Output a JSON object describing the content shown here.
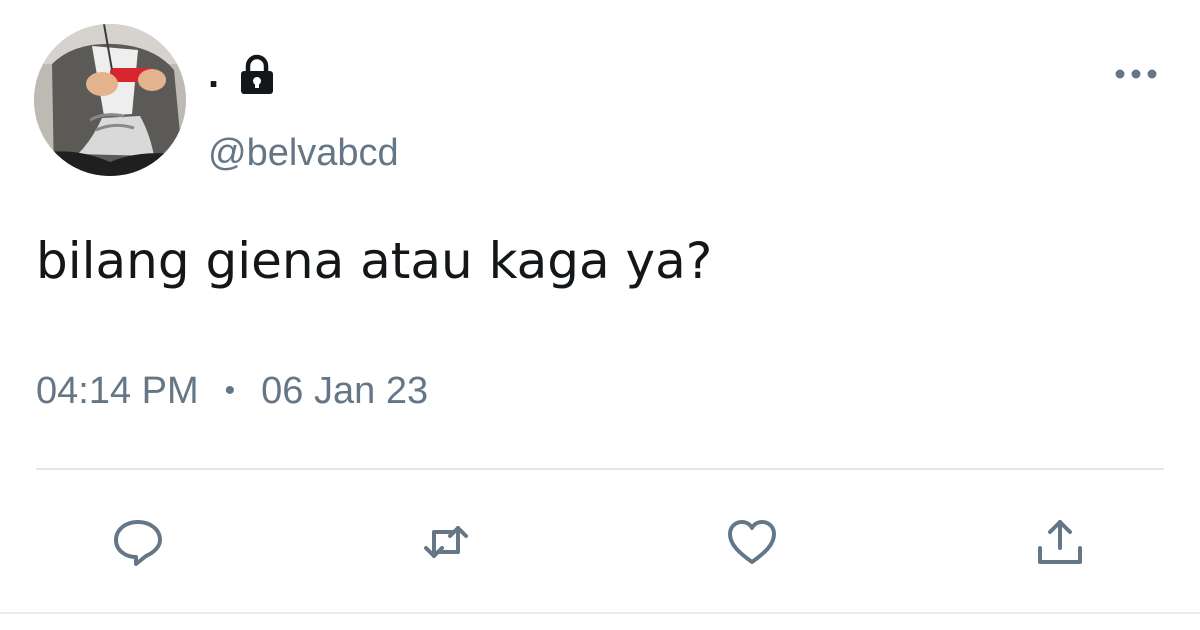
{
  "tweet": {
    "display_name": ".",
    "protected_icon": "lock-icon",
    "handle": "@belvabcd",
    "text": "bilang giena atau kaga ya?",
    "time": "04:14 PM",
    "separator": "•",
    "date": "06 Jan 23"
  },
  "actions": {
    "reply_icon": "comment-bubble-icon",
    "retweet_icon": "retweet-arrows-icon",
    "like_icon": "heart-outline-icon",
    "share_icon": "share-upload-icon",
    "more_icon": "more-dots-icon"
  },
  "colors": {
    "text_primary": "#14171a",
    "text_secondary": "#657786",
    "icon": "#657786",
    "divider": "#e1e8ed",
    "background": "#ffffff"
  }
}
